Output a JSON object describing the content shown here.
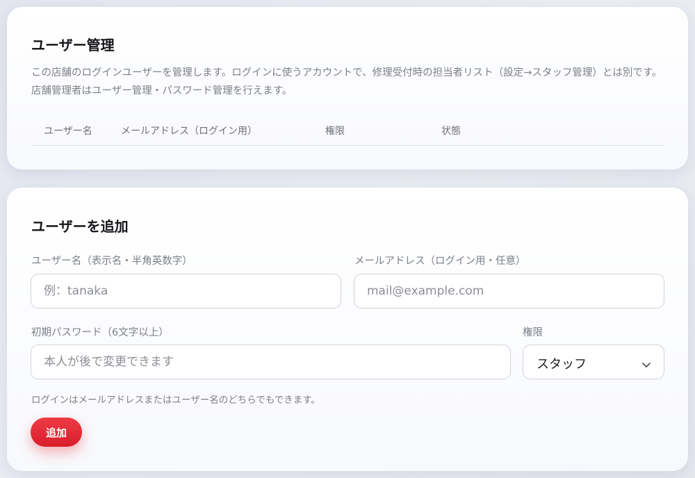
{
  "users_section": {
    "title": "ユーザー管理",
    "description": "この店舗のログインユーザーを管理します。ログインに使うアカウントで、修理受付時の担当者リスト（設定→スタッフ管理）とは別です。店舗管理者はユーザー管理・パスワード管理を行えます。",
    "columns": [
      "ユーザー名",
      "メールアドレス（ログイン用）",
      "権限",
      "状態"
    ]
  },
  "add_section": {
    "title": "ユーザーを追加",
    "username": {
      "label": "ユーザー名（表示名・半角英数字）",
      "placeholder": "例：tanaka"
    },
    "email": {
      "label": "メールアドレス（ログイン用・任意）",
      "placeholder": "mail@example.com"
    },
    "password": {
      "label": "初期パスワード（6文字以上）",
      "placeholder": "本人が後で変更できます"
    },
    "role": {
      "label": "権限",
      "selected": "スタッフ",
      "icon": "chevron-down-icon"
    },
    "hint": "ログインはメールアドレスまたはユーザー名のどちらでもできます。",
    "submit_label": "追加"
  },
  "colors": {
    "accent": "#e0232f",
    "muted_text": "#7c7f88",
    "border": "#cfd2da"
  }
}
